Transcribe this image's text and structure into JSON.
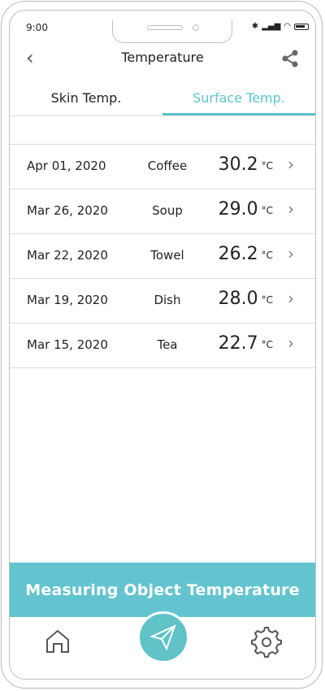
{
  "status": {
    "time": "9:00"
  },
  "header": {
    "title": "Temperature"
  },
  "tabs": [
    {
      "label": "Skin Temp.",
      "active": false
    },
    {
      "label": "Surface Temp.",
      "active": true
    }
  ],
  "records": [
    {
      "date": "Apr 01, 2020",
      "object": "Coffee",
      "value": "30.2",
      "unit": "°C"
    },
    {
      "date": "Mar 26, 2020",
      "object": "Soup",
      "value": "29.0",
      "unit": "°C"
    },
    {
      "date": "Mar 22, 2020",
      "object": "Towel",
      "value": "26.2",
      "unit": "°C"
    },
    {
      "date": "Mar 19, 2020",
      "object": "Dish",
      "value": "28.0",
      "unit": "°C"
    },
    {
      "date": "Mar 15, 2020",
      "object": "Tea",
      "value": "22.7",
      "unit": "°C"
    }
  ],
  "banner": {
    "text": "Measuring Object Temperature"
  },
  "colors": {
    "accent": "#63c4cf",
    "text": "#222222",
    "divider": "#dcdcdc"
  },
  "icons": {
    "back": "chevron-left-icon",
    "share": "share-icon",
    "row_chevron": "chevron-right-icon",
    "home": "home-icon",
    "send": "paper-plane-icon",
    "settings": "gear-icon",
    "bluetooth": "bluetooth-icon",
    "signal": "signal-icon",
    "wifi": "wifi-icon",
    "battery": "battery-icon"
  }
}
